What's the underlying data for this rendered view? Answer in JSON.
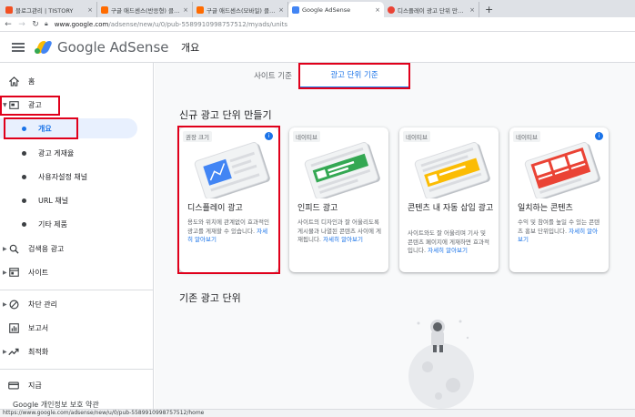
{
  "browser": {
    "tabs": [
      {
        "title": "블로그관리 | TISTORY",
        "color": "#f25022"
      },
      {
        "title": "구글 애드센스(반응형) 클라고인",
        "color": "#ff6b00"
      },
      {
        "title": "구글 애드센스(모바일) 클라고인",
        "color": "#ff6b00"
      },
      {
        "title": "Google AdSense",
        "color": "#4285f4"
      },
      {
        "title": "디스플레이 광고 단위 만들기 - /",
        "color": "#ea4335"
      }
    ],
    "new_tab": "+",
    "url_host": "www.google.com",
    "url_path": "/adsense/new/u/0/pub-5589910998757512/myads/units",
    "status_url": "https://www.google.com/adsense/new/u/0/pub-5589910998757512/home"
  },
  "header": {
    "brand": "Google AdSense",
    "page_title": "개요"
  },
  "sidebar": {
    "items": [
      {
        "label": "홈",
        "icon": "home-icon"
      },
      {
        "label": "광고",
        "icon": "ads-icon"
      },
      {
        "label": "개요"
      },
      {
        "label": "광고 게재율"
      },
      {
        "label": "사용자설정 채널"
      },
      {
        "label": "URL 채널"
      },
      {
        "label": "기타 제품"
      },
      {
        "label": "검색용 광고",
        "icon": "search-ads-icon"
      },
      {
        "label": "사이트",
        "icon": "sites-icon"
      },
      {
        "label": "차단 관리",
        "icon": "block-icon"
      },
      {
        "label": "보고서",
        "icon": "reports-icon"
      },
      {
        "label": "최적화",
        "icon": "optimize-icon"
      },
      {
        "label": "지급",
        "icon": "payments-icon"
      }
    ],
    "footer_text": "Google  개인정보 보호  약관"
  },
  "main": {
    "tabs": [
      {
        "label": "사이트 기준"
      },
      {
        "label": "광고 단위 기준"
      }
    ],
    "new_section_title": "신규 광고 단위 만들기",
    "existing_section_title": "기존 광고 단위",
    "cards": [
      {
        "badge": "권장 크기",
        "title": "디스플레이 광고",
        "desc": "용도와 위치에 관계없이 효과적인 광고를 게재할 수 있습니다.",
        "link": "자세히 알아보기",
        "accent": "#4285f4"
      },
      {
        "badge": "네이티브",
        "title": "인피드 광고",
        "desc": "사이트의 디자인과 잘 어울리도록 게시물과 나열된 콘텐츠 사이에 게재됩니다.",
        "link": "자세히 알아보기",
        "accent": "#34a853"
      },
      {
        "badge": "네이티브",
        "title": "콘텐츠 내 자동 삽입 광고",
        "desc": "사이트와도 잘 어울리며 기사 및 콘텐츠 페이지에 게재하면 효과적입니다.",
        "link": "자세히 알아보기",
        "accent": "#fbbc04"
      },
      {
        "badge": "네이티브",
        "title": "일치하는 콘텐츠",
        "desc": "수익 및 참여를 높일 수 있는 콘텐츠 홍보 단위입니다.",
        "link": "자세히 알아보기",
        "accent": "#ea4335"
      }
    ]
  }
}
